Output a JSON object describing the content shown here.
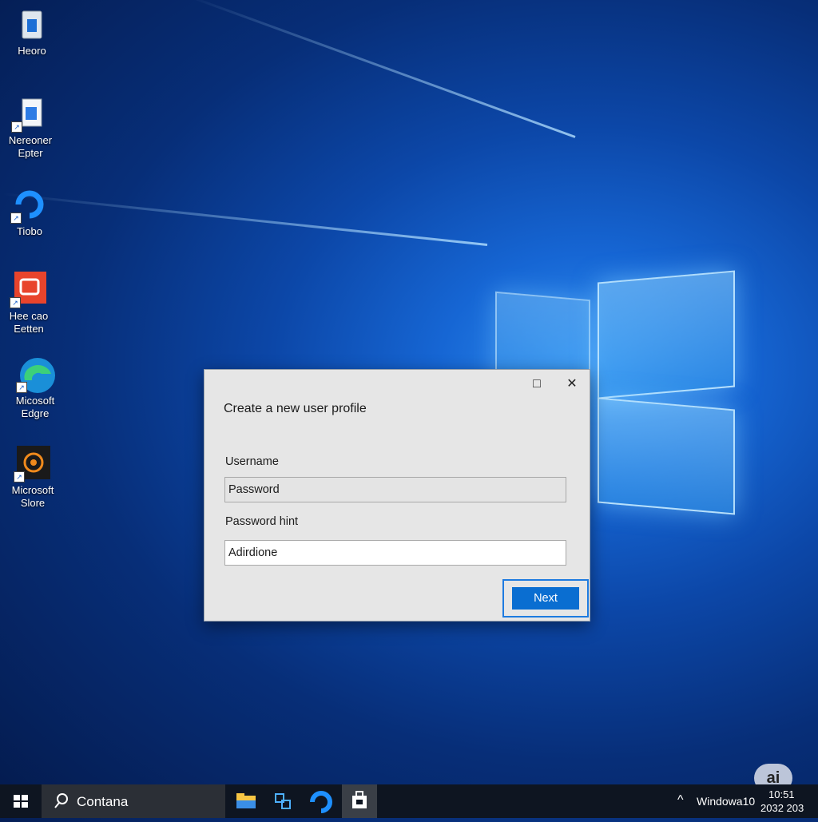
{
  "desktop": {
    "icons": [
      {
        "label": "Heoro"
      },
      {
        "label": "Nereoner Epter"
      },
      {
        "label": "Tiobo"
      },
      {
        "label": "Hee cao Eetten"
      },
      {
        "label": "Micosoft Edgre"
      },
      {
        "label": "Microsoft Slore"
      }
    ]
  },
  "dialog": {
    "maximize_icon": "□",
    "close_icon": "✕",
    "title": "Create a new user profile",
    "username_label": "Username",
    "username_value": "Password",
    "hint_label": "Password hint",
    "hint_value": "Adirdione",
    "next_label": "Next"
  },
  "taskbar": {
    "search_label": "Contana",
    "tray_label": "Windowa10",
    "time": "10:51",
    "date": "2032 203"
  },
  "watermark": "ai",
  "colors": {
    "accent": "#0a6ed1",
    "taskbar": "#0e1521"
  }
}
